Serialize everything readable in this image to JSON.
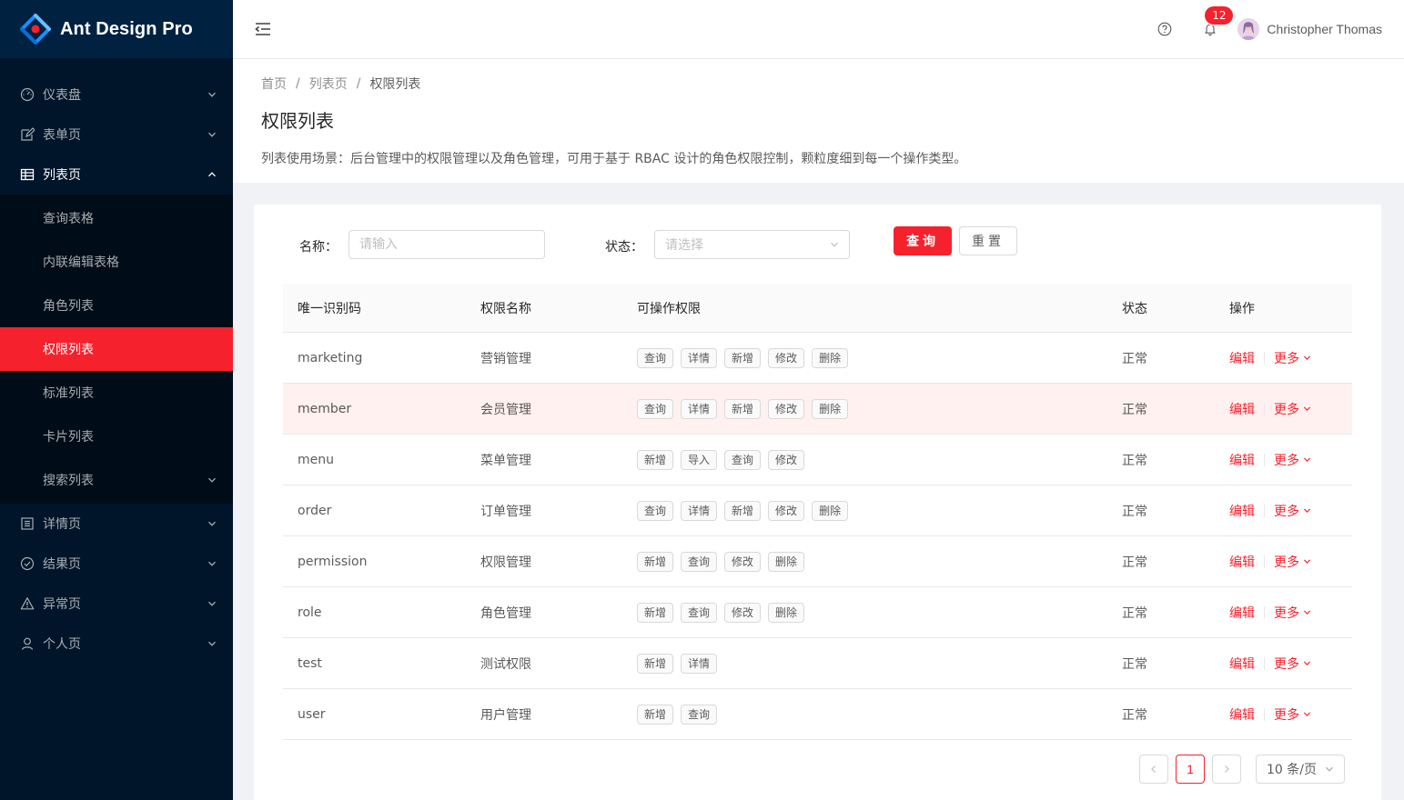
{
  "app": {
    "title": "Ant Design Pro"
  },
  "sidebar": {
    "items": [
      {
        "label": "仪表盘",
        "icon": "dashboard-icon"
      },
      {
        "label": "表单页",
        "icon": "form-icon"
      },
      {
        "label": "列表页",
        "icon": "table-icon",
        "open": true,
        "children": [
          {
            "label": "查询表格"
          },
          {
            "label": "内联编辑表格"
          },
          {
            "label": "角色列表"
          },
          {
            "label": "权限列表",
            "active": true
          },
          {
            "label": "标准列表"
          },
          {
            "label": "卡片列表"
          },
          {
            "label": "搜索列表",
            "has_children": true
          }
        ]
      },
      {
        "label": "详情页",
        "icon": "profile-icon"
      },
      {
        "label": "结果页",
        "icon": "check-circle-icon"
      },
      {
        "label": "异常页",
        "icon": "warning-icon"
      },
      {
        "label": "个人页",
        "icon": "user-icon"
      }
    ]
  },
  "header": {
    "notification_count": "12",
    "user_name": "Christopher Thomas"
  },
  "page_header": {
    "breadcrumb": [
      "首页",
      "列表页",
      "权限列表"
    ],
    "title": "权限列表",
    "description": "列表使用场景：后台管理中的权限管理以及角色管理，可用于基于 RBAC 设计的角色权限控制，颗粒度细到每一个操作类型。"
  },
  "search_form": {
    "name_label": "名称：",
    "name_placeholder": "请输入",
    "status_label": "状态：",
    "status_placeholder": "请选择",
    "query_button": "查询",
    "reset_button": "重置"
  },
  "table": {
    "columns": [
      "唯一识别码",
      "权限名称",
      "可操作权限",
      "状态",
      "操作"
    ],
    "rows": [
      {
        "code": "marketing",
        "name": "营销管理",
        "actions": [
          "查询",
          "详情",
          "新增",
          "修改",
          "删除"
        ],
        "status": "正常"
      },
      {
        "code": "member",
        "name": "会员管理",
        "actions": [
          "查询",
          "详情",
          "新增",
          "修改",
          "删除"
        ],
        "status": "正常",
        "highlighted": true
      },
      {
        "code": "menu",
        "name": "菜单管理",
        "actions": [
          "新增",
          "导入",
          "查询",
          "修改"
        ],
        "status": "正常"
      },
      {
        "code": "order",
        "name": "订单管理",
        "actions": [
          "查询",
          "详情",
          "新增",
          "修改",
          "删除"
        ],
        "status": "正常"
      },
      {
        "code": "permission",
        "name": "权限管理",
        "actions": [
          "新增",
          "查询",
          "修改",
          "删除"
        ],
        "status": "正常"
      },
      {
        "code": "role",
        "name": "角色管理",
        "actions": [
          "新增",
          "查询",
          "修改",
          "删除"
        ],
        "status": "正常"
      },
      {
        "code": "test",
        "name": "测试权限",
        "actions": [
          "新增",
          "详情"
        ],
        "status": "正常"
      },
      {
        "code": "user",
        "name": "用户管理",
        "actions": [
          "新增",
          "查询"
        ],
        "status": "正常"
      }
    ],
    "edit_label": "编辑",
    "more_label": "更多"
  },
  "pagination": {
    "current_page": "1",
    "page_size": "10 条/页"
  },
  "colors": {
    "primary": "#f5222d",
    "sider": "#001529",
    "sider_logo": "#002140",
    "submenu": "#000c17",
    "row_highlight": "#fff1f0"
  }
}
